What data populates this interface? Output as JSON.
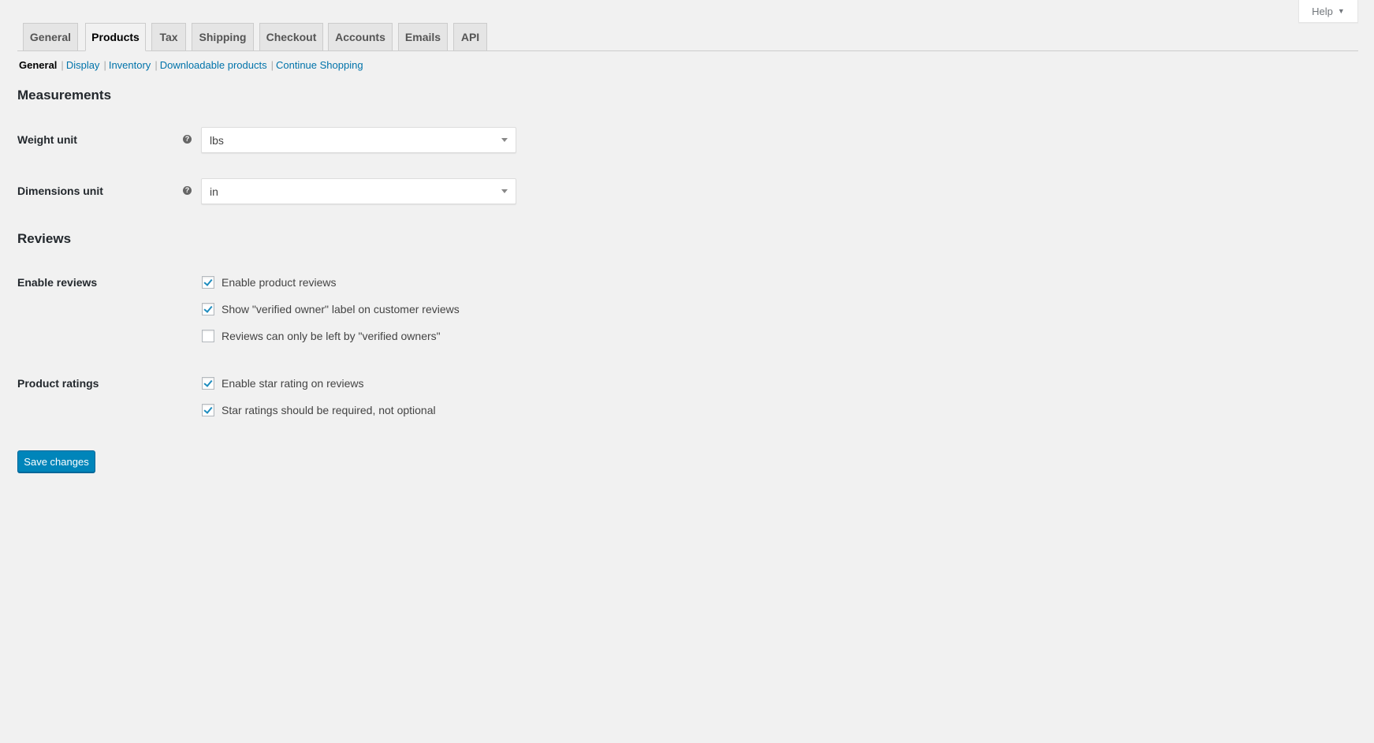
{
  "help_button": {
    "label": "Help",
    "icon": "caret-down-icon"
  },
  "tabs": [
    {
      "label": "General",
      "active": false
    },
    {
      "label": "Products",
      "active": true
    },
    {
      "label": "Tax",
      "active": false
    },
    {
      "label": "Shipping",
      "active": false
    },
    {
      "label": "Checkout",
      "active": false
    },
    {
      "label": "Accounts",
      "active": false
    },
    {
      "label": "Emails",
      "active": false
    },
    {
      "label": "API",
      "active": false
    }
  ],
  "subnav": {
    "current": "General",
    "links": [
      "Display",
      "Inventory",
      "Downloadable products",
      "Continue Shopping"
    ],
    "separator": "|"
  },
  "sections": {
    "measurements": {
      "title": "Measurements",
      "weight_unit": {
        "label": "Weight unit",
        "value": "lbs",
        "help_icon": "?"
      },
      "dimensions_unit": {
        "label": "Dimensions unit",
        "value": "in",
        "help_icon": "?"
      }
    },
    "reviews": {
      "title": "Reviews",
      "enable_reviews": {
        "label": "Enable reviews",
        "options": [
          {
            "label": "Enable product reviews",
            "checked": true
          },
          {
            "label": "Show \"verified owner\" label on customer reviews",
            "checked": true
          },
          {
            "label": "Reviews can only be left by \"verified owners\"",
            "checked": false
          }
        ]
      },
      "product_ratings": {
        "label": "Product ratings",
        "options": [
          {
            "label": "Enable star rating on reviews",
            "checked": true
          },
          {
            "label": "Star ratings should be required, not optional",
            "checked": true
          }
        ]
      }
    }
  },
  "save_button": {
    "label": "Save changes"
  },
  "colors": {
    "accent": "#0085ba",
    "link": "#0073aa",
    "checkmark": "#1e8cbe",
    "background": "#f1f1f1"
  }
}
